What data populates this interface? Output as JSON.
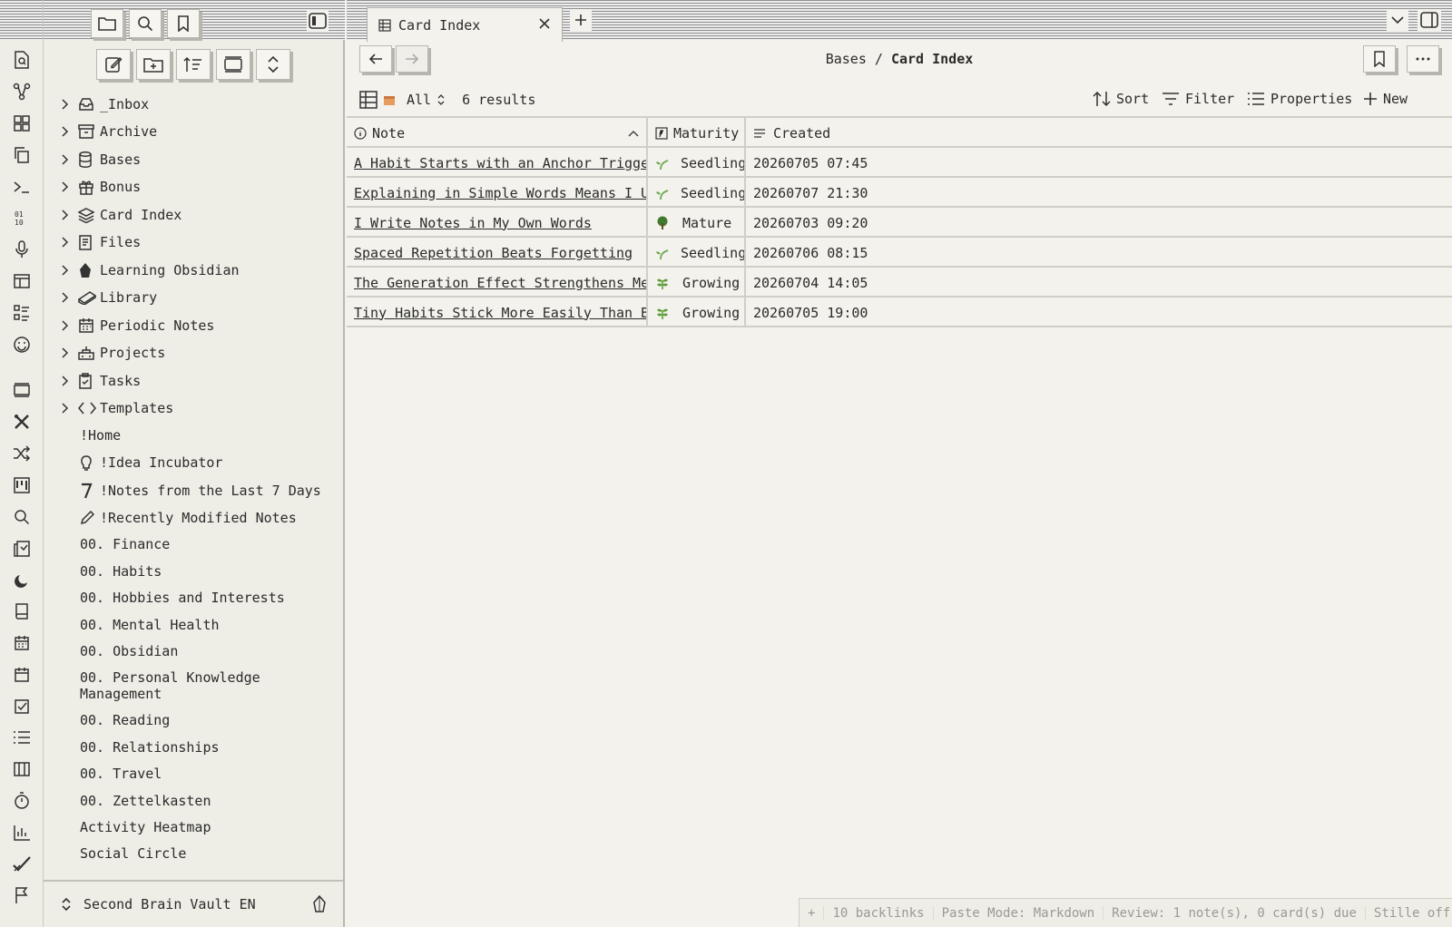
{
  "ribbon": {
    "icons": [
      "file-search-icon",
      "graph-icon",
      "dashboard-icon",
      "copy-icon",
      "terminal-icon",
      "number-list-icon",
      "microphone-icon",
      "layout-icon",
      "checklist-icon",
      "face-icon",
      "slides-icon",
      "tools-icon",
      "shuffle-icon",
      "kanban-icon",
      "search-icon",
      "flashcards-icon",
      "moon-icon",
      "book-icon",
      "calendar-icon",
      "calendar-week-icon",
      "checkbox-icon",
      "list-icon",
      "columns-icon",
      "timer-icon",
      "bar-chart-icon",
      "brush-check-icon",
      "flag-icon"
    ]
  },
  "sidebar": {
    "folders": [
      {
        "label": "_Inbox",
        "icon": "inbox-icon"
      },
      {
        "label": "Archive",
        "icon": "archive-icon"
      },
      {
        "label": "Bases",
        "icon": "database-icon"
      },
      {
        "label": "Bonus",
        "icon": "gift-icon"
      },
      {
        "label": "Card Index",
        "icon": "layers-icon"
      },
      {
        "label": "Files",
        "icon": "files-icon"
      },
      {
        "label": "Learning Obsidian",
        "icon": "obsidian-icon"
      },
      {
        "label": "Library",
        "icon": "books-icon"
      },
      {
        "label": "Periodic Notes",
        "icon": "calendar-icon"
      },
      {
        "label": "Projects",
        "icon": "projects-icon"
      },
      {
        "label": "Tasks",
        "icon": "task-icon"
      },
      {
        "label": "Templates",
        "icon": "code-icon"
      }
    ],
    "files": [
      {
        "label": "!Home",
        "icon": ""
      },
      {
        "label": "!Idea Incubator",
        "icon": "lightbulb-icon"
      },
      {
        "label": "!Notes from the Last 7 Days",
        "icon": "seven-icon"
      },
      {
        "label": "!Recently Modified Notes",
        "icon": "pencil-icon"
      },
      {
        "label": "00. Finance",
        "icon": ""
      },
      {
        "label": "00. Habits",
        "icon": ""
      },
      {
        "label": "00. Hobbies and Interests",
        "icon": ""
      },
      {
        "label": "00. Mental Health",
        "icon": ""
      },
      {
        "label": "00. Obsidian",
        "icon": ""
      },
      {
        "label": "00. Personal Knowledge Management",
        "icon": ""
      },
      {
        "label": "00. Reading",
        "icon": ""
      },
      {
        "label": "00. Relationships",
        "icon": ""
      },
      {
        "label": "00. Travel",
        "icon": ""
      },
      {
        "label": "00. Zettelkasten",
        "icon": ""
      },
      {
        "label": "Activity Heatmap",
        "icon": ""
      },
      {
        "label": "Social Circle",
        "icon": ""
      }
    ],
    "vault_name": "Second Brain Vault EN"
  },
  "tab": {
    "title": "Card Index"
  },
  "breadcrumb": {
    "parent": "Bases",
    "separator": "/",
    "current": "Card Index"
  },
  "bases_bar": {
    "view_name": "All",
    "results": "6 results",
    "sort_label": "Sort",
    "filter_label": "Filter",
    "properties_label": "Properties",
    "new_label": "New"
  },
  "table": {
    "columns": [
      "Note",
      "Maturity",
      "Created"
    ],
    "rows": [
      {
        "note": "A Habit Starts with an Anchor Trigger",
        "maturity": "Seedling",
        "icon": "seedling-icon",
        "created": "20260705 07:45"
      },
      {
        "note": "Explaining in Simple Words Means I Understand",
        "maturity": "Seedling",
        "icon": "seedling-icon",
        "created": "20260707 21:30"
      },
      {
        "note": "I Write Notes in My Own Words",
        "maturity": "Mature",
        "icon": "tree-icon",
        "created": "20260703 09:20"
      },
      {
        "note": "Spaced Repetition Beats Forgetting",
        "maturity": "Seedling",
        "icon": "seedling-icon",
        "created": "20260706 08:15"
      },
      {
        "note": "The Generation Effect Strengthens Memory",
        "maturity": "Growing",
        "icon": "herb-icon",
        "created": "20260704 14:05"
      },
      {
        "note": "Tiny Habits Stick More Easily Than Big Ones",
        "maturity": "Growing",
        "icon": "herb-icon",
        "created": "20260705 19:00"
      }
    ]
  },
  "status_bar": {
    "backlinks": "10 backlinks",
    "paste_mode": "Paste Mode: Markdown",
    "review": "Review: 1 note(s), 0 card(s) due",
    "stille": "Stille off"
  },
  "colors": {
    "background": "#f3f2ec",
    "sidebar": "#eeede6",
    "seedling": "#6aa84f",
    "mature": "#3f7a2d",
    "growing": "#5e9e3a"
  }
}
